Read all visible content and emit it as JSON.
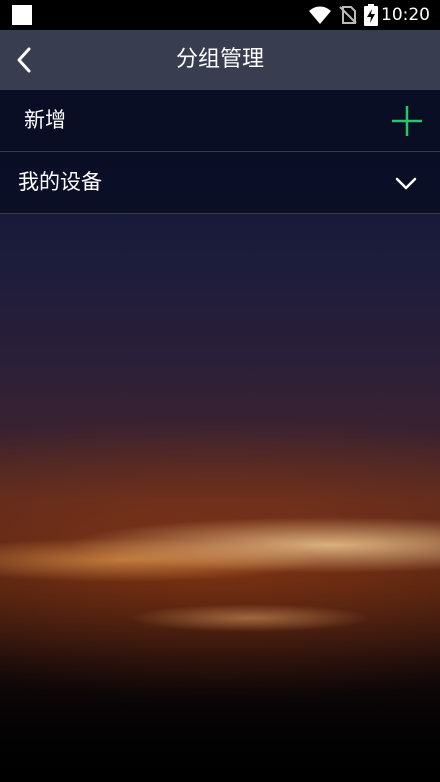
{
  "status_bar": {
    "time": "10:20"
  },
  "header": {
    "title": "分组管理",
    "back_icon": "chevron-left-icon"
  },
  "actions": {
    "add_label": "新增",
    "add_icon": "plus-icon",
    "add_icon_color": "#2bc46a"
  },
  "groups": [
    {
      "label": "我的设备",
      "expand_icon": "chevron-down-icon"
    }
  ]
}
